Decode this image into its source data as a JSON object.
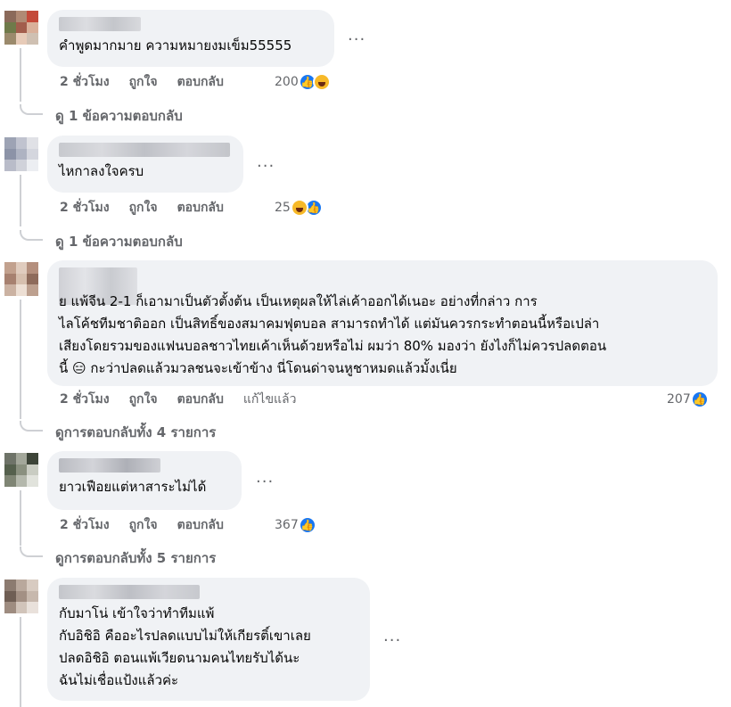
{
  "comments": [
    {
      "text": "คำพูดมากมาย ความหมายงมเข็ม55555",
      "time": "2 ชั่วโมง",
      "like": "ถูกใจ",
      "reply": "ตอบกลับ",
      "edited": "",
      "reaction_count": "200",
      "reactions": [
        "like-icon",
        "haha-icon"
      ],
      "replies_label": "ดู 1 ข้อความตอบกลับ"
    },
    {
      "text": "ไหกาลงใจครบ",
      "time": "2 ชั่วโมง",
      "like": "ถูกใจ",
      "reply": "ตอบกลับ",
      "edited": "",
      "reaction_count": "25",
      "reactions": [
        "haha-icon",
        "like-icon"
      ],
      "replies_label": "ดู 1 ข้อความตอบกลับ"
    },
    {
      "text": "ย แพ้จีน 2-1 ก็เอามาเป็นตัวตั้งต้น เป็นเหตุผลให้ไล่เค้าออกได้เนอะ อย่างที่กล่าว การ\nไลโค้ชทีมชาติออก เป็นสิทธิ์ของสมาคมฟุตบอล สามารถทำได้ แต่มันควรกระทำตอนนี้หรือเปล่า\nเสียงโดยรวมของแฟนบอลชาวไทยเค้าเห็นด้วยหรือไม่ ผมว่า 80% มองว่า ยังไงก็ไม่ควรปลดตอน\nนี้ 😑 กะว่าปลดแล้วมวลชนจะเข้าข้าง นี่โดนด่าจนหูชาหมดแล้วมั้งเนี่ย",
      "time": "2 ชั่วโมง",
      "like": "ถูกใจ",
      "reply": "ตอบกลับ",
      "edited": "แก้ไขแล้ว",
      "reaction_count": "207",
      "reactions": [
        "like-icon"
      ],
      "replies_label": "ดูการตอบกลับทั้ง 4 รายการ"
    },
    {
      "text": "ยาวเฟือยแต่หาสาระไม่ได้",
      "time": "2 ชั่วโมง",
      "like": "ถูกใจ",
      "reply": "ตอบกลับ",
      "edited": "",
      "reaction_count": "367",
      "reactions": [
        "like-icon"
      ],
      "replies_label": "ดูการตอบกลับทั้ง 5 รายการ"
    },
    {
      "text": "กับมาโน่ เข้าใจว่าทำทีมแพ้\nกับอิชิอิ คืออะไรปลดแบบไม่ให้เกียรติ์เขาเลย\nปลดอิชิอิ ตอนแพ้เวียดนามคนไทยรับได้นะ\nฉันไม่เชื่อแป้งแล้วค่ะ",
      "time": "",
      "like": "",
      "reply": "",
      "edited": "",
      "reaction_count": "",
      "reactions": [],
      "replies_label": ""
    }
  ],
  "more_label": "···"
}
